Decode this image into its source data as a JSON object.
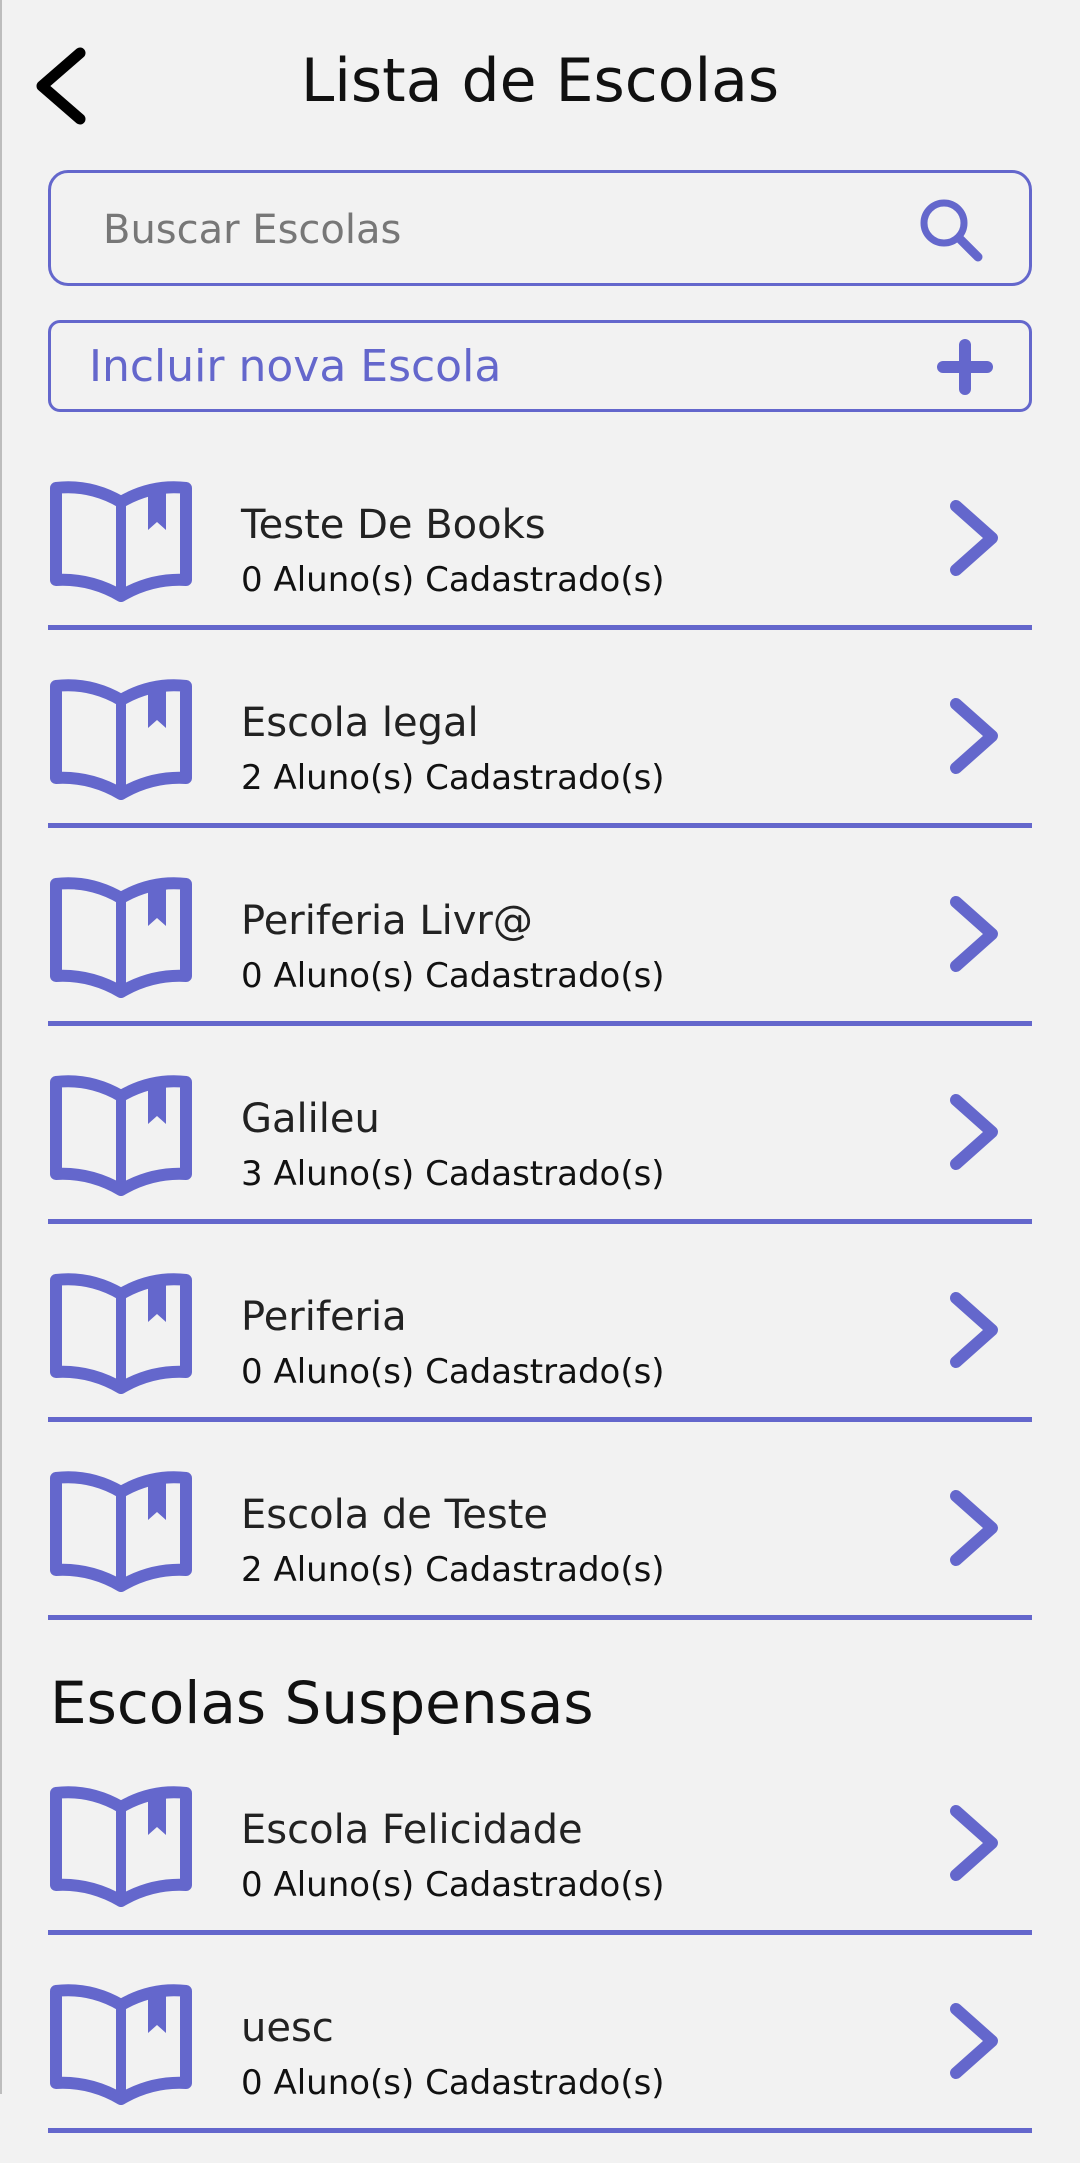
{
  "header": {
    "title": "Lista de Escolas"
  },
  "search": {
    "placeholder": "Buscar Escolas",
    "value": ""
  },
  "add_button": {
    "label": "Incluir nova Escola"
  },
  "schools": [
    {
      "name": "Teste De Books",
      "count": "0 Aluno(s) Cadastrado(s)"
    },
    {
      "name": "Escola legal",
      "count": "2 Aluno(s) Cadastrado(s)"
    },
    {
      "name": "Periferia Livr@",
      "count": "0 Aluno(s) Cadastrado(s)"
    },
    {
      "name": "Galileu",
      "count": "3 Aluno(s) Cadastrado(s)"
    },
    {
      "name": "Periferia",
      "count": "0 Aluno(s) Cadastrado(s)"
    },
    {
      "name": "Escola de Teste",
      "count": "2 Aluno(s) Cadastrado(s)"
    }
  ],
  "suspended": {
    "title": "Escolas Suspensas",
    "schools": [
      {
        "name": "Escola Felicidade",
        "count": "0 Aluno(s) Cadastrado(s)"
      },
      {
        "name": "uesc",
        "count": "0 Aluno(s) Cadastrado(s)"
      }
    ]
  },
  "colors": {
    "accent": "#6467cc",
    "background": "#f2f2f2",
    "text": "#111111"
  },
  "icons": {
    "back": "chevron-left-icon",
    "search": "search-icon",
    "add": "plus-icon",
    "school": "open-book-icon",
    "open": "chevron-right-icon"
  }
}
